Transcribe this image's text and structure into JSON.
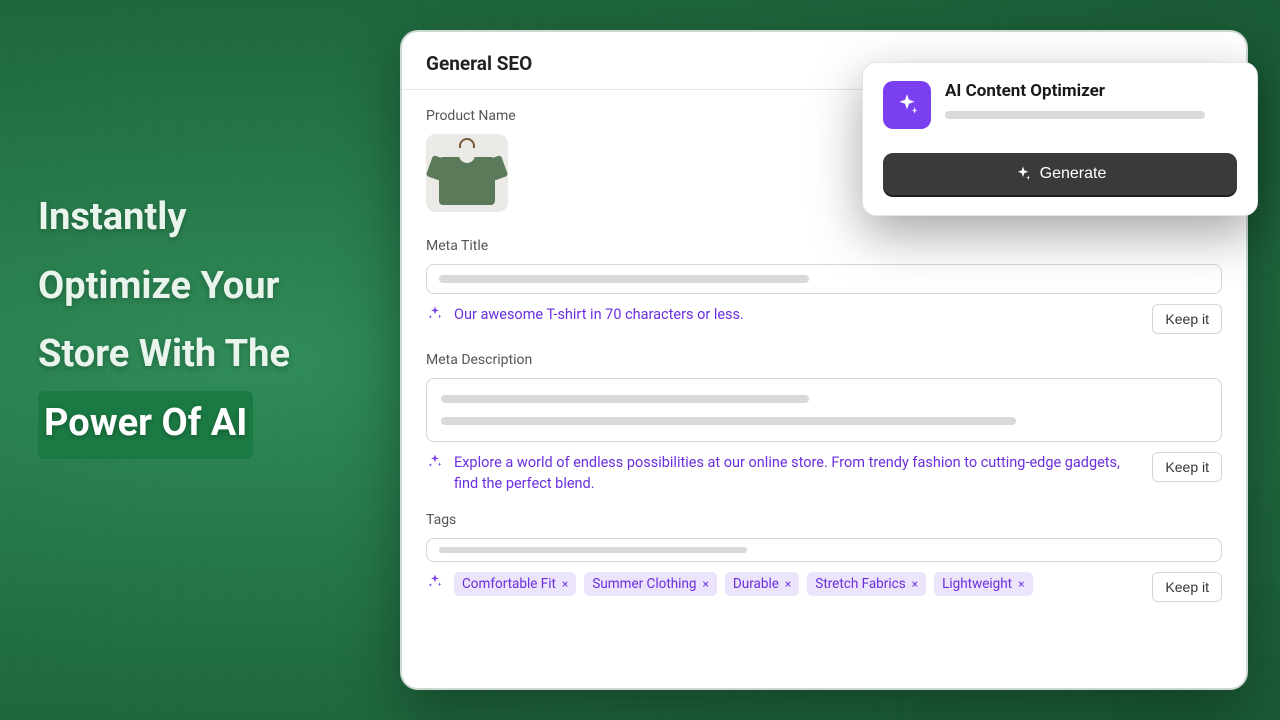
{
  "headline": {
    "line1": "Instantly",
    "line2": "Optimize Your",
    "line3": "Store With The",
    "line4_highlight": "Power Of AI"
  },
  "panel": {
    "title": "General SEO",
    "product_name_label": "Product Name",
    "meta_title": {
      "label": "Meta Title",
      "suggestion": "Our awesome T-shirt in 70 characters or less.",
      "keep_label": "Keep it"
    },
    "meta_description": {
      "label": "Meta Description",
      "suggestion": "Explore a world of endless possibilities at our online store. From trendy fashion to cutting-edge gadgets, find the  perfect blend.",
      "keep_label": "Keep it"
    },
    "tags": {
      "label": "Tags",
      "chips": [
        "Comfortable Fit",
        "Summer Clothing",
        "Durable",
        "Stretch Fabrics",
        "Lightweight"
      ],
      "keep_label": "Keep it"
    }
  },
  "ai_card": {
    "title": "AI Content Optimizer",
    "generate_label": "Generate"
  }
}
